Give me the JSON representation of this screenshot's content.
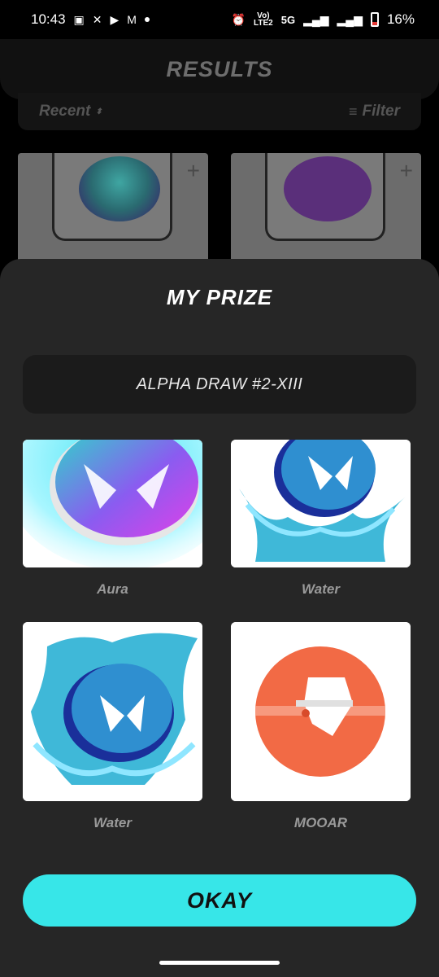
{
  "status_bar": {
    "time": "10:43",
    "network_label_top": "Vo)",
    "network_label_mid": "LTE2",
    "network_type": "5G",
    "battery": "16%"
  },
  "background": {
    "title": "RESULTS",
    "sort_label": "Recent",
    "filter_label": "Filter"
  },
  "sheet": {
    "title": "MY PRIZE",
    "draw_name": "ALPHA DRAW #2-XIII",
    "prizes": [
      {
        "label": "Aura",
        "icon": "aura-coin-icon"
      },
      {
        "label": "Water",
        "icon": "water-coin-icon"
      },
      {
        "label": "Water",
        "icon": "water-coin-icon"
      },
      {
        "label": "MOOAR",
        "icon": "mooar-logo-icon"
      }
    ],
    "okay_label": "OKAY"
  },
  "colors": {
    "accent": "#37e6e8",
    "sheet_bg": "#262626",
    "mooar_orange": "#f26a45"
  }
}
